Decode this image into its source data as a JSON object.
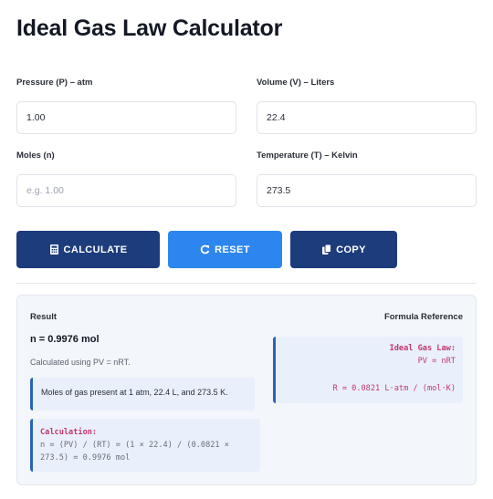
{
  "title": "Ideal Gas Law Calculator",
  "fields": {
    "pressure": {
      "label": "Pressure (P) – atm",
      "value": "1.00"
    },
    "volume": {
      "label": "Volume (V) – Liters",
      "value": "22.4"
    },
    "moles": {
      "label": "Moles (n)",
      "value": "",
      "placeholder": "e.g. 1.00"
    },
    "temperature": {
      "label": "Temperature (T) – Kelvin",
      "value": "273.5"
    }
  },
  "buttons": {
    "calculate": "CALCULATE",
    "reset": "RESET",
    "copy": "COPY"
  },
  "result": {
    "heading": "Result",
    "value": "n = 0.9976 mol",
    "method": "Calculated using PV = nRT.",
    "note": "Moles of gas present at 1 atm, 22.4 L, and 273.5 K.",
    "calc_title": "Calculation:",
    "calc_line1": "n = (PV) / (RT) = (1 × 22.4) / (0.0821 ×",
    "calc_line2": "273.5) = 0.9976 mol"
  },
  "formula": {
    "heading": "Formula Reference",
    "title": "Ideal Gas Law:",
    "equation": "PV = nRT",
    "constant": "R = 0.0821 L·atm / (mol·K)"
  },
  "colors": {
    "navy": "#1d3c7b",
    "blue": "#2d86ee",
    "accent_border": "#2a63b8",
    "code_pink": "#c4366d"
  },
  "icons": {
    "calculate": "calculator-icon",
    "reset": "refresh-icon",
    "copy": "copy-icon"
  }
}
